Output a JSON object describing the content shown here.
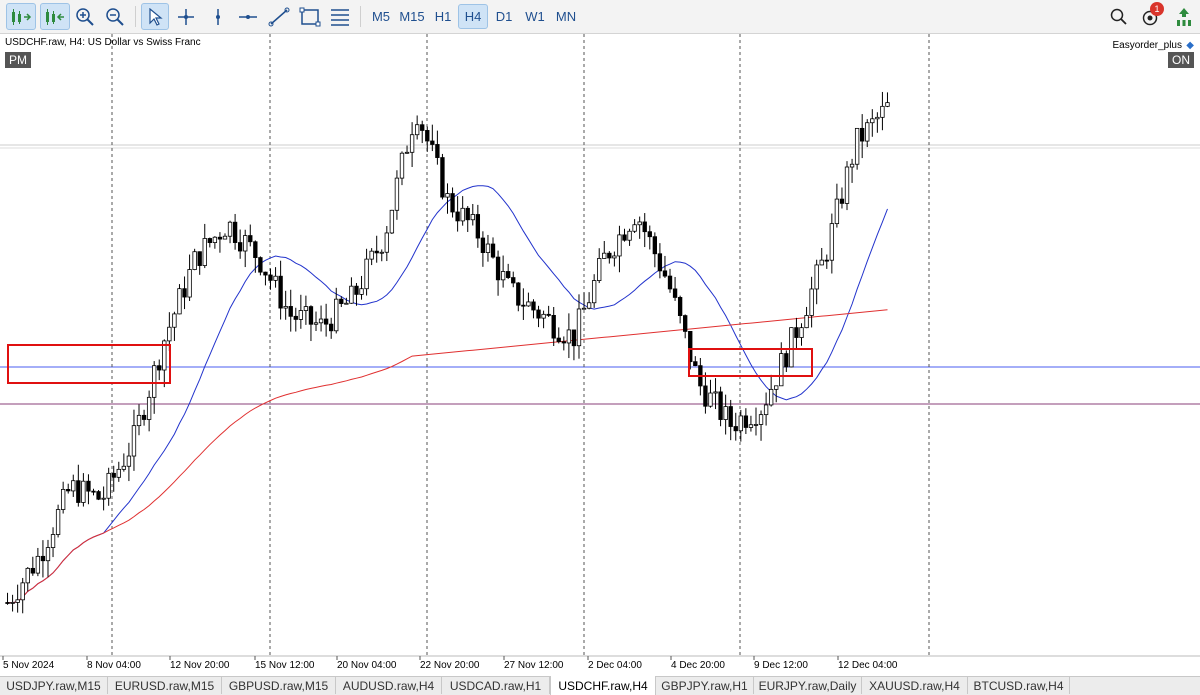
{
  "toolbar": {
    "tools": [
      {
        "name": "auto-trading-icon",
        "active": true
      },
      {
        "name": "one-click-trading-icon",
        "active": true
      },
      {
        "name": "zoom-in-icon",
        "active": false
      },
      {
        "name": "zoom-out-icon",
        "active": false
      },
      {
        "name": "cursor-icon",
        "active": true
      },
      {
        "name": "crosshair-icon",
        "active": false
      },
      {
        "name": "vertical-line-icon",
        "active": false
      },
      {
        "name": "horizontal-line-icon",
        "active": false
      },
      {
        "name": "trendline-icon",
        "active": false
      },
      {
        "name": "rectangle-icon",
        "active": false
      },
      {
        "name": "fibonacci-icon",
        "active": false
      }
    ],
    "timeframes": [
      "M5",
      "M15",
      "H1",
      "H4",
      "D1",
      "W1",
      "MN"
    ],
    "active_timeframe": "H4",
    "notification_count": "1",
    "right_icons": [
      "search-icon",
      "notifications-icon",
      "signal-level-icon"
    ]
  },
  "chart": {
    "title": "USDCHF.raw, H4:  US Dollar vs Swiss Franc",
    "session_badge": "PM",
    "expert_name": "Easyorder_plus",
    "expert_status": "ON"
  },
  "chart_data": {
    "type": "candlestick",
    "symbol": "USDCHF.raw",
    "timeframe": "H4",
    "x_tick_labels": [
      "5 Nov 2024",
      "8 Nov 04:00",
      "12 Nov 20:00",
      "15 Nov 12:00",
      "20 Nov 04:00",
      "22 Nov 20:00",
      "27 Nov 12:00",
      "2 Dec 04:00",
      "4 Dec 20:00",
      "9 Dec 12:00",
      "12 Dec 04:00"
    ],
    "period_separators": [
      "8 Nov",
      "15 Nov",
      "22 Nov",
      "2 Dec",
      "6 Dec",
      "12 Dec"
    ],
    "close_path": [
      [
        "5 Nov 2024",
        0.02
      ],
      [
        "6 Nov",
        0.1
      ],
      [
        "7 Nov",
        0.22
      ],
      [
        "8 Nov",
        0.2
      ],
      [
        "11 Nov",
        0.3
      ],
      [
        "12 Nov",
        0.48
      ],
      [
        "13 Nov",
        0.62
      ],
      [
        "14 Nov",
        0.68
      ],
      [
        "15 Nov",
        0.62
      ],
      [
        "18 Nov",
        0.52
      ],
      [
        "19 Nov",
        0.5
      ],
      [
        "20 Nov",
        0.55
      ],
      [
        "21 Nov",
        0.66
      ],
      [
        "22 Nov",
        0.88
      ],
      [
        "25 Nov",
        0.72
      ],
      [
        "26 Nov",
        0.66
      ],
      [
        "27 Nov",
        0.56
      ],
      [
        "28 Nov",
        0.52
      ],
      [
        "29 Nov",
        0.48
      ],
      [
        "2 Dec",
        0.62
      ],
      [
        "3 Dec",
        0.7
      ],
      [
        "4 Dec",
        0.58
      ],
      [
        "5 Dec",
        0.4
      ],
      [
        "6 Dec",
        0.33
      ],
      [
        "9 Dec",
        0.36
      ],
      [
        "10 Dec",
        0.48
      ],
      [
        "11 Dec",
        0.62
      ],
      [
        "12 Dec",
        0.82
      ],
      [
        "13 Dec",
        0.88
      ]
    ],
    "indicators": [
      {
        "kind": "moving-average",
        "color": "#2233cc"
      },
      {
        "kind": "moving-average",
        "color": "#e03030"
      }
    ],
    "horizontal_lines": [
      {
        "kind": "level",
        "color": "#4a5cf0"
      },
      {
        "kind": "level",
        "color": "#8a3f7a"
      },
      {
        "kind": "price-line",
        "color": "#cccccc"
      }
    ],
    "annotations": [
      {
        "kind": "rectangle",
        "color": "#e01010",
        "from": "5 Nov 2024",
        "to": "8 Nov 04:00"
      },
      {
        "kind": "rectangle",
        "color": "#e01010",
        "from": "4 Dec 20:00",
        "to": "9 Dec 12:00"
      }
    ],
    "grid": false,
    "colors": {
      "bull": "#ffffff",
      "bear": "#000000",
      "wick": "#000000"
    }
  },
  "symbol_tabs": [
    {
      "label": "USDJPY.raw,M15",
      "active": false
    },
    {
      "label": "EURUSD.raw,M15",
      "active": false
    },
    {
      "label": "GBPUSD.raw,M15",
      "active": false
    },
    {
      "label": "AUDUSD.raw,H4",
      "active": false
    },
    {
      "label": "USDCAD.raw,H1",
      "active": false
    },
    {
      "label": "USDCHF.raw,H4",
      "active": true
    },
    {
      "label": "GBPJPY.raw,H1",
      "active": false
    },
    {
      "label": "EURJPY.raw,Daily",
      "active": false
    },
    {
      "label": "XAUUSD.raw,H4",
      "active": false
    },
    {
      "label": "BTCUSD.raw,H4",
      "active": false
    }
  ]
}
